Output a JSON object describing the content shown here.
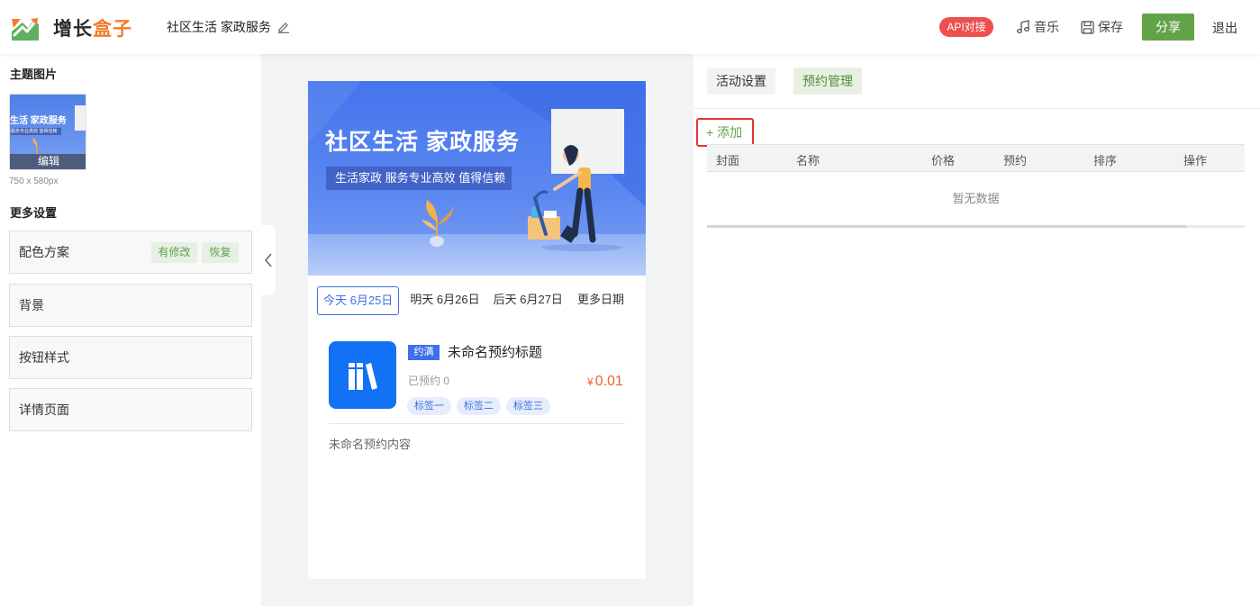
{
  "header": {
    "logo_dark": "增长",
    "logo_orange": "盒子",
    "activity_title": "社区生活 家政服务",
    "api_badge": "API对接",
    "music_label": "音乐",
    "save_label": "保存",
    "share_label": "分享",
    "exit_label": "退出"
  },
  "left_panel": {
    "theme_image_title": "主题图片",
    "thumb_title": "生活 家政服务",
    "thumb_subtitle": "服务专业高效 值得信赖",
    "thumb_edit_label": "编辑",
    "thumb_size": "750 x 580px",
    "more_settings_title": "更多设置",
    "settings": [
      {
        "label": "配色方案"
      },
      {
        "label": "背景"
      },
      {
        "label": "按钮样式"
      },
      {
        "label": "详情页面"
      }
    ],
    "modified_label": "有修改",
    "restore_label": "恢复"
  },
  "preview": {
    "banner_title": "社区生活 家政服务",
    "banner_subtitle": "生活家政 服务专业高效 值得信赖",
    "dates": [
      {
        "label": "今天 6月25日",
        "active": true
      },
      {
        "label": "明天 6月26日",
        "active": false
      },
      {
        "label": "后天 6月27日",
        "active": false
      },
      {
        "label": "更多日期",
        "active": false
      }
    ],
    "item": {
      "badge": "约满",
      "title": "未命名预约标题",
      "booked": "已预约 0",
      "currency": "¥",
      "price": "0.01",
      "tags": [
        "标签一",
        "标签二",
        "标签三"
      ],
      "content": "未命名预约内容"
    }
  },
  "right_panel": {
    "tabs": [
      {
        "label": "活动设置",
        "active": false
      },
      {
        "label": "预约管理",
        "active": true
      }
    ],
    "add_label": "+ 添加",
    "columns": [
      "封面",
      "名称",
      "价格",
      "预约",
      "排序",
      "操作"
    ],
    "empty_text": "暂无数据"
  },
  "colors": {
    "brand_green": "#62a34a",
    "brand_orange": "#f47a2b",
    "api_red": "#ee4f4f",
    "preview_blue": "#3d6fe8",
    "price_orange": "#f25f2c"
  }
}
